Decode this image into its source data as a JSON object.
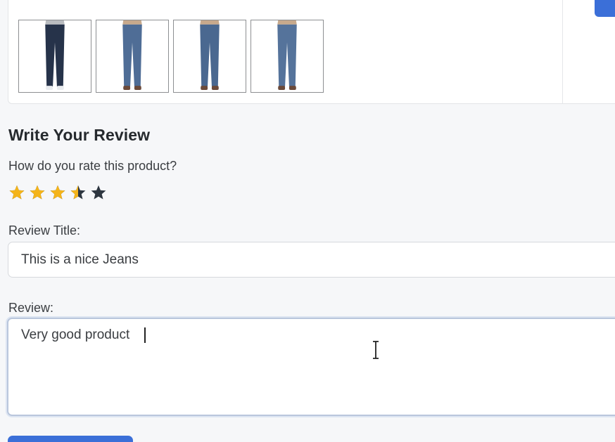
{
  "product": {
    "thumbnails": [
      {
        "name": "jeans-front-dark",
        "wash": "#26334a"
      },
      {
        "name": "jeans-front-blue",
        "wash": "#4f6d96"
      },
      {
        "name": "jeans-front-blue-alt",
        "wash": "#4a6890"
      },
      {
        "name": "jeans-back-blue",
        "wash": "#55739b"
      }
    ]
  },
  "review": {
    "heading": "Write Your Review",
    "rate_prompt": "How do you rate this product?",
    "rating": 3.5,
    "rating_max": 5,
    "star_filled_color": "#f4b41a",
    "star_empty_color": "#2d3640",
    "title_label": "Review Title:",
    "title_value": "This is a nice Jeans",
    "body_label": "Review:",
    "body_value": "Very good product"
  },
  "colors": {
    "accent": "#3b6fd8"
  }
}
